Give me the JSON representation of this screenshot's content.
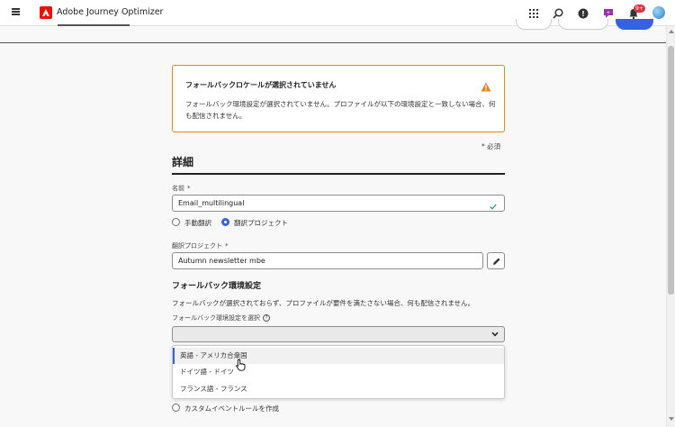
{
  "app": {
    "title": "Adobe Journey Optimizer",
    "notification_count": "9+",
    "icons": [
      "menu-icon",
      "adobe-logo-icon",
      "apps-grid-icon",
      "search-icon",
      "help-icon",
      "feedback-icon",
      "bell-icon",
      "avatar"
    ]
  },
  "warning": {
    "title": "フォールバックロケールが選択されていません",
    "body": "フォールバック環境設定が選択されていません。プロファイルが以下の環境設定と一致しない場合、何も配信されません。",
    "color": "#e68619"
  },
  "form": {
    "required_note": "* 必須",
    "section_title": "詳細",
    "name_label": "名前",
    "name_value": "Email_multilingual",
    "radio_manual": "手動翻訳",
    "radio_project": "翻訳プロジェクト",
    "project_label": "翻訳プロジェクト",
    "project_value": "Autumn newsletter mbe",
    "fallback_title": "フォールバック環境設定",
    "fallback_desc": "フォールバックが選択されておらず、プロファイルが要件を満たさない場合、何も配信されません。",
    "fallback_select_label": "フォールバック環境設定を選択",
    "required_mark": "*",
    "info_mark": "?"
  },
  "dropdown": {
    "options": [
      "英語 - アメリカ合衆国",
      "ドイツ語 - ドイツ",
      "フランス語 - フランス"
    ],
    "hovered_index": 0
  },
  "bottom": {
    "radio_label": "カスタムイベントルールを作成"
  },
  "colors": {
    "accent": "#3562e1",
    "warning": "#e68619",
    "brand": "#eb1000",
    "success": "#2d9d78"
  }
}
